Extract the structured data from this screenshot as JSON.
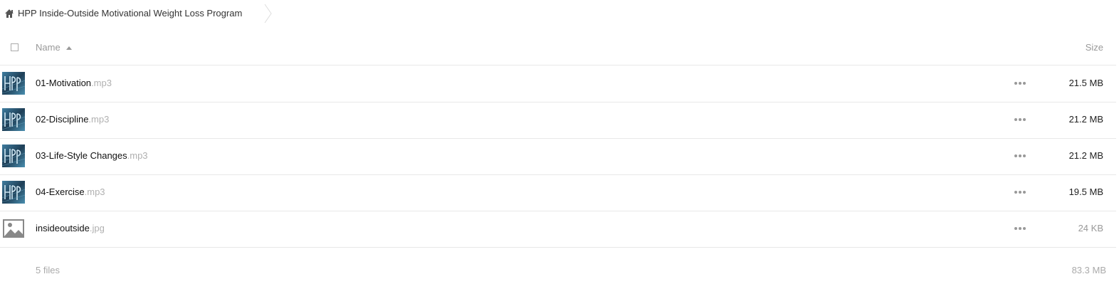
{
  "breadcrumb": {
    "folder_name": "HPP Inside-Outside Motivational Weight Loss Program"
  },
  "header": {
    "name_label": "Name",
    "size_label": "Size"
  },
  "files": [
    {
      "base": "01-Motivation",
      "ext": ".mp3",
      "size": "21.5 MB",
      "thumb": "hpp-audio-thumbnail"
    },
    {
      "base": "02-Discipline",
      "ext": ".mp3",
      "size": "21.2 MB",
      "thumb": "hpp-audio-thumbnail"
    },
    {
      "base": "03-Life-Style Changes",
      "ext": ".mp3",
      "size": "21.2 MB",
      "thumb": "hpp-audio-thumbnail"
    },
    {
      "base": "04-Exercise",
      "ext": ".mp3",
      "size": "19.5 MB",
      "thumb": "hpp-audio-thumbnail"
    },
    {
      "base": "insideoutside",
      "ext": ".jpg",
      "size": "24 KB",
      "thumb": "image-icon"
    }
  ],
  "summary": {
    "count": "5 files",
    "total_size": "83.3 MB"
  }
}
